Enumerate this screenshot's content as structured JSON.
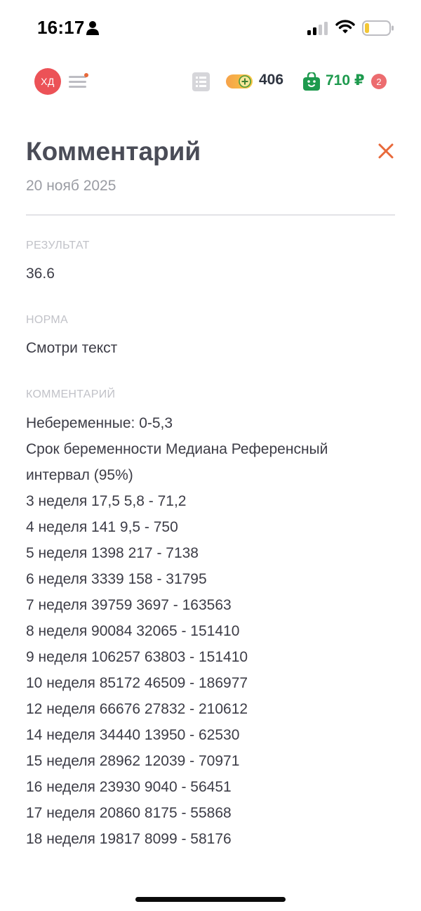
{
  "status_bar": {
    "time": "16:17"
  },
  "header": {
    "avatar_initials": "ХД",
    "coins": "406",
    "wallet": "710 ₽",
    "cart_count": "2"
  },
  "title": "Комментарий",
  "date": "20 нояб 2025",
  "result": {
    "label": "РЕЗУЛЬТАТ",
    "value": "36.6"
  },
  "norm": {
    "label": "НОРМА",
    "value": "Смотри текст"
  },
  "comment": {
    "label": "КОММЕНТАРИЙ",
    "lines": [
      "Небеременные: 0-5,3",
      "Срок беременности Медиана Референсный",
      "интервал (95%)",
      "3 неделя 17,5 5,8 - 71,2",
      "4 неделя 141 9,5 - 750",
      "5 неделя 1398 217 - 7138",
      "6 неделя 3339 158 - 31795",
      "7 неделя 39759 3697 - 163563",
      "8 неделя 90084 32065 - 151410",
      "9 неделя 106257 63803 - 151410",
      "10 неделя 85172 46509 - 186977",
      "12 неделя 66676 27832 - 210612",
      "14 неделя 34440 13950 - 62530",
      "15 неделя 28962 12039 - 70971",
      "16 неделя 23930 9040 - 56451",
      "17 неделя 20860 8175 - 55868",
      "18 неделя 19817 8099 - 58176"
    ]
  },
  "colors": {
    "avatar_bg": "#ec5257",
    "accent_orange": "#e8693a",
    "wallet_green": "#1e9a4e",
    "badge_red": "#ec6c6f"
  },
  "icons": {
    "person": "person-icon",
    "signal": "cellular-signal-icon",
    "wifi": "wifi-icon",
    "battery": "battery-icon",
    "menu": "menu-icon",
    "list": "list-icon",
    "coins": "coins-toggle-icon",
    "bag": "shopping-bag-icon",
    "close": "close-icon"
  }
}
